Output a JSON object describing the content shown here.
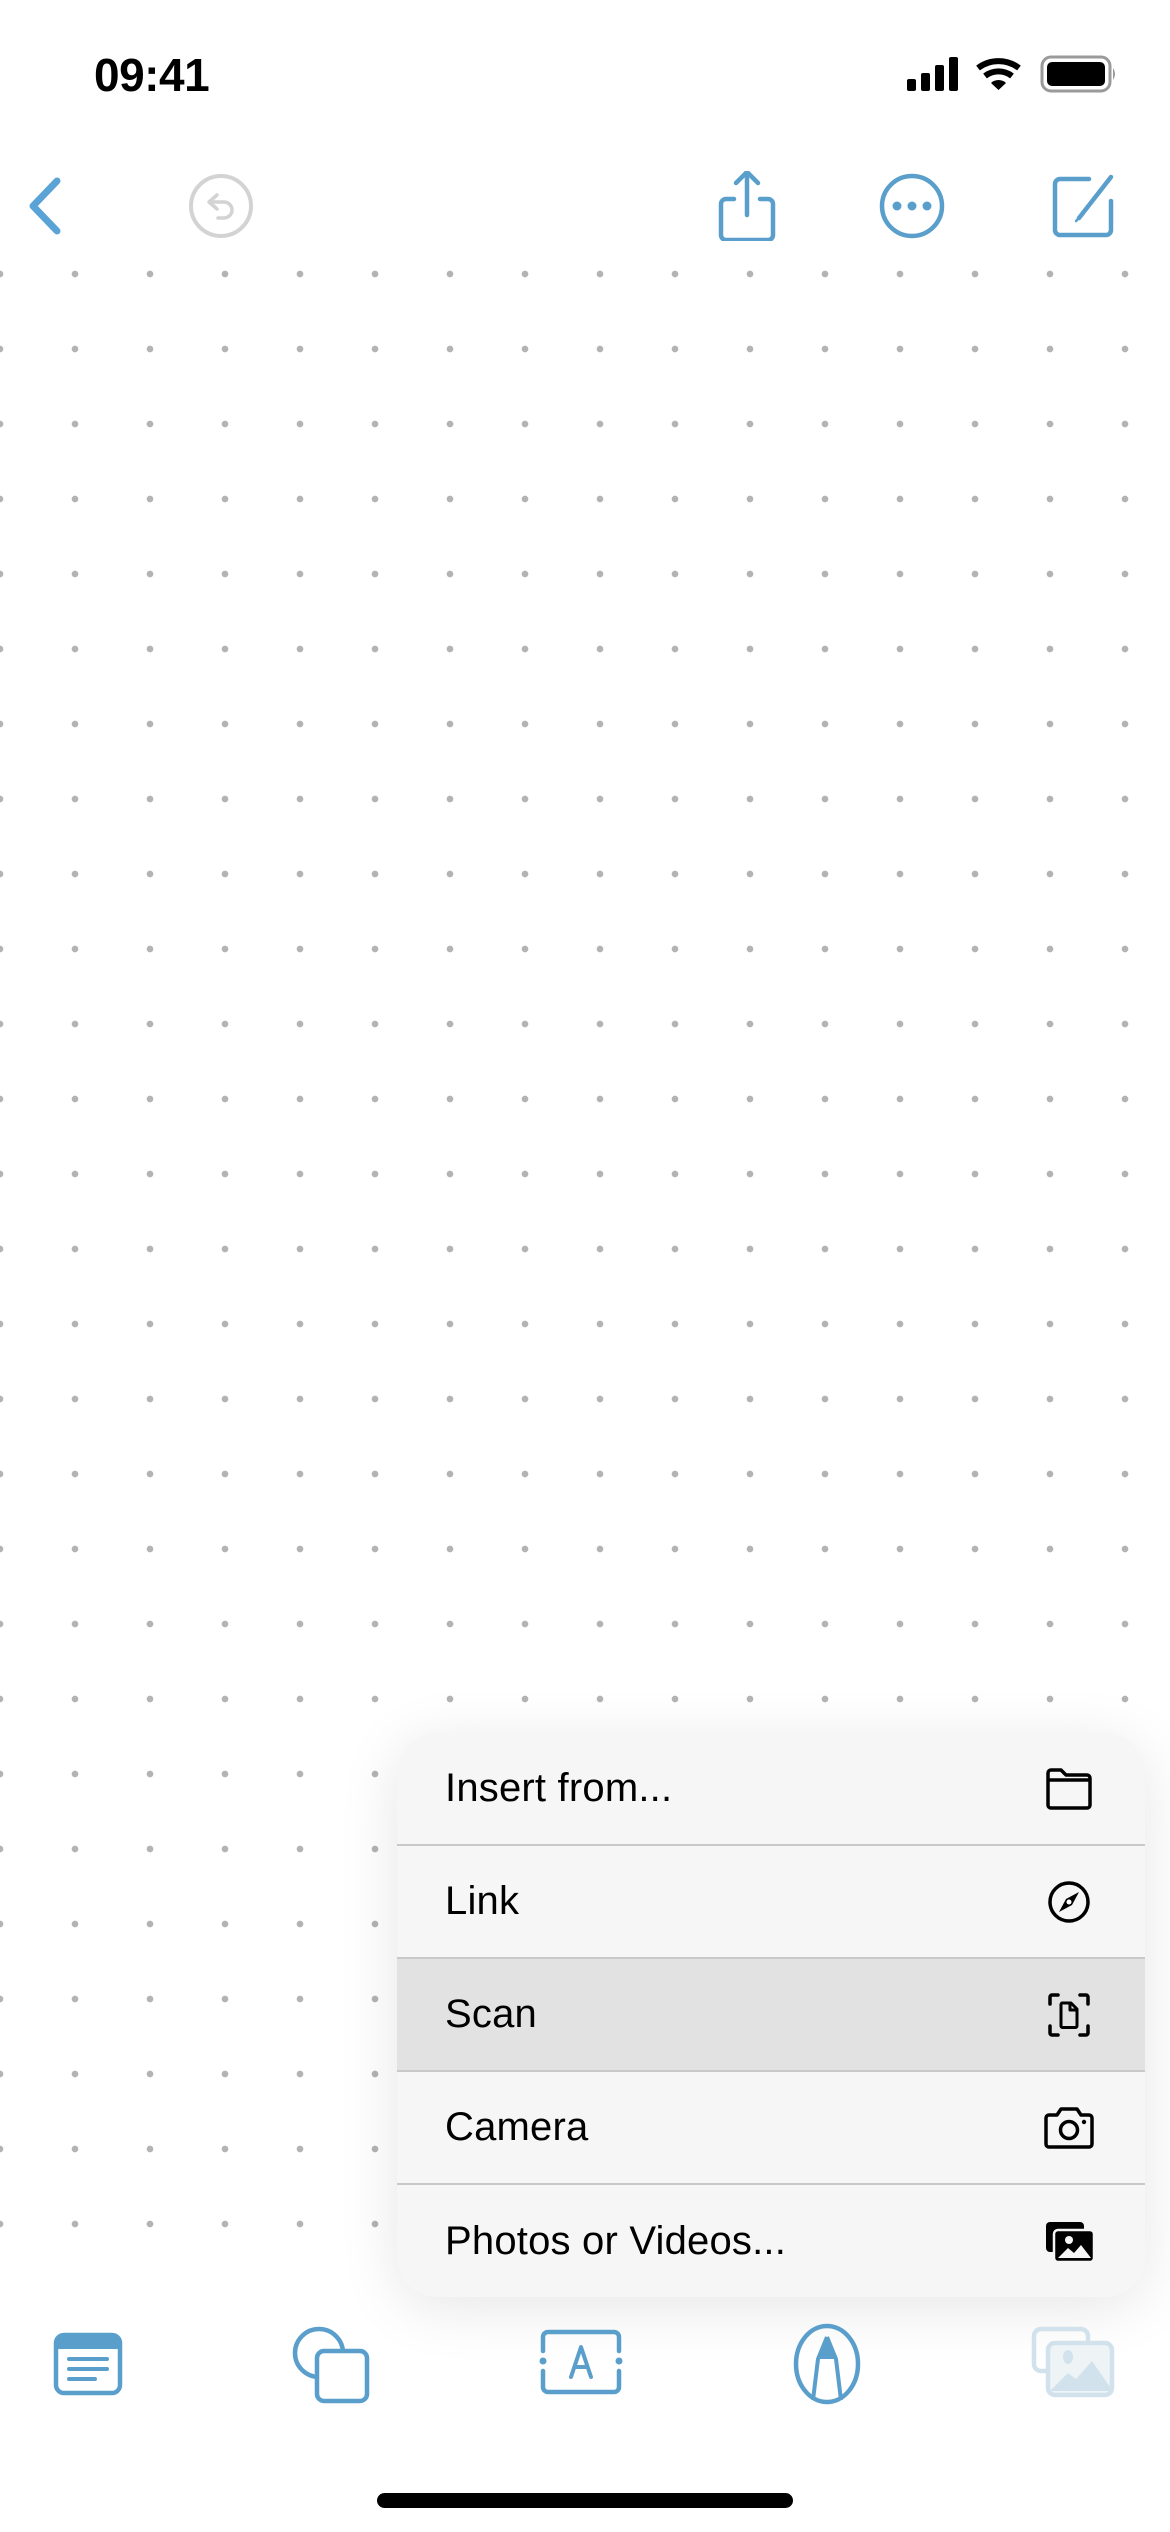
{
  "status_bar": {
    "time": "09:41",
    "icons": [
      "cellular-signal-icon",
      "wifi-icon",
      "battery-icon"
    ]
  },
  "top_toolbar": {
    "left": [
      {
        "name": "back-button",
        "icon": "chevron-left-icon",
        "enabled": true
      },
      {
        "name": "undo-button",
        "icon": "undo-icon",
        "enabled": false
      }
    ],
    "right": [
      {
        "name": "share-button",
        "icon": "share-icon",
        "enabled": true
      },
      {
        "name": "more-button",
        "icon": "ellipsis-circle-icon",
        "enabled": true
      },
      {
        "name": "compose-button",
        "icon": "square-pencil-icon",
        "enabled": true
      }
    ]
  },
  "canvas": {
    "background": "dot-grid"
  },
  "insert_menu": {
    "items": [
      {
        "label": "Insert from...",
        "icon": "folder-icon",
        "highlighted": false
      },
      {
        "label": "Link",
        "icon": "compass-icon",
        "highlighted": false
      },
      {
        "label": "Scan",
        "icon": "document-scan-icon",
        "highlighted": true
      },
      {
        "label": "Camera",
        "icon": "camera-icon",
        "highlighted": false
      },
      {
        "label": "Photos or Videos...",
        "icon": "photo-stack-icon",
        "highlighted": false
      }
    ]
  },
  "bottom_toolbar": {
    "items": [
      {
        "name": "sticky-note-tool",
        "icon": "sticky-note-icon",
        "enabled": true
      },
      {
        "name": "shapes-tool",
        "icon": "shapes-icon",
        "enabled": true
      },
      {
        "name": "text-box-tool",
        "icon": "text-box-icon",
        "enabled": true
      },
      {
        "name": "pen-tool",
        "icon": "pen-tip-icon",
        "enabled": true
      },
      {
        "name": "media-tool",
        "icon": "photo-stack-icon",
        "enabled": true,
        "active": true
      }
    ]
  },
  "colors": {
    "accent": "#5a9fcc",
    "disabled": "#cfcfcf",
    "menu_background": "#f6f6f6",
    "menu_highlight": "#e2e2e2",
    "dot": "#b3b3b3"
  }
}
